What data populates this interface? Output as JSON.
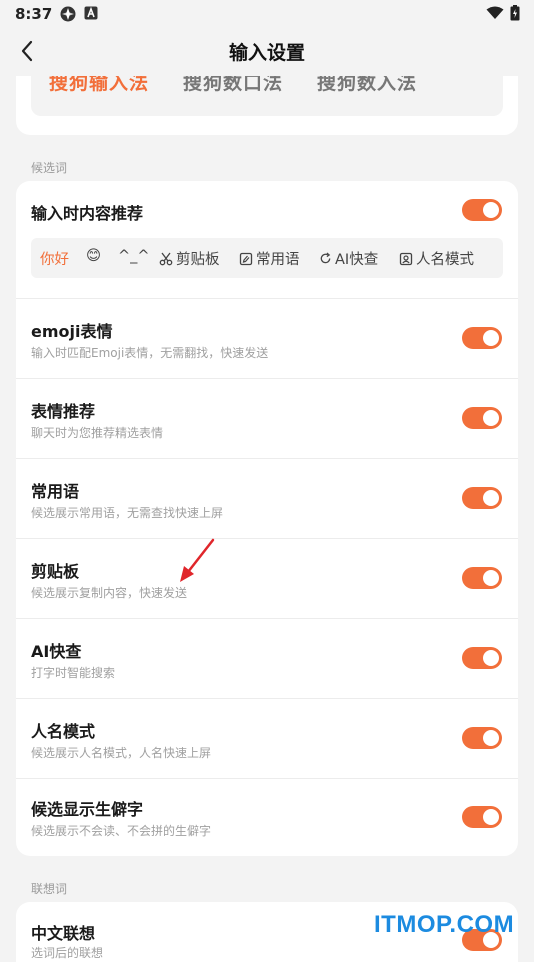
{
  "status_bar": {
    "time": "8:37",
    "icons": [
      "nav-app-icon",
      "a-badge-icon",
      "wifi-icon",
      "battery-icon"
    ]
  },
  "header": {
    "title": "输入设置",
    "back_icon": "chevron-left-icon"
  },
  "layouts": {
    "items": [
      {
        "label": "搜狗输入法",
        "active": true
      },
      {
        "label": "搜狗数口法",
        "active": false
      },
      {
        "label": "搜狗数入法",
        "active": false
      }
    ]
  },
  "sections": {
    "candidates": "候选词",
    "association": "联想词"
  },
  "candidate_preview": {
    "items": [
      "你好",
      "😊",
      "^_^",
      "剪贴板",
      "常用语",
      "AI快查",
      "人名模式"
    ]
  },
  "settings": [
    {
      "title": "输入时内容推荐",
      "subtitle": "",
      "enabled": true
    },
    {
      "title": "emoji表情",
      "subtitle": "输入时匹配Emoji表情，无需翻找，快速发送",
      "enabled": true
    },
    {
      "title": "表情推荐",
      "subtitle": "聊天时为您推荐精选表情",
      "enabled": true
    },
    {
      "title": "常用语",
      "subtitle": "候选展示常用语，无需查找快速上屏",
      "enabled": true
    },
    {
      "title": "剪贴板",
      "subtitle": "候选展示复制内容，快速发送",
      "enabled": true
    },
    {
      "title": "AI快查",
      "subtitle": "打字时智能搜索",
      "enabled": true
    },
    {
      "title": "人名模式",
      "subtitle": "候选展示人名模式，人名快速上屏",
      "enabled": true
    },
    {
      "title": "候选显示生僻字",
      "subtitle": "候选展示不会读、不会拼的生僻字",
      "enabled": true
    }
  ],
  "association_settings": [
    {
      "title": "中文联想",
      "subtitle": "选词后的联想",
      "enabled": true
    }
  ],
  "colors": {
    "accent": "#f26f3a",
    "background": "#f3f3f3",
    "card": "#ffffff",
    "annotation_arrow": "#e0262b",
    "watermark": "#1c8be0"
  },
  "watermark": "ITMOP.COM"
}
